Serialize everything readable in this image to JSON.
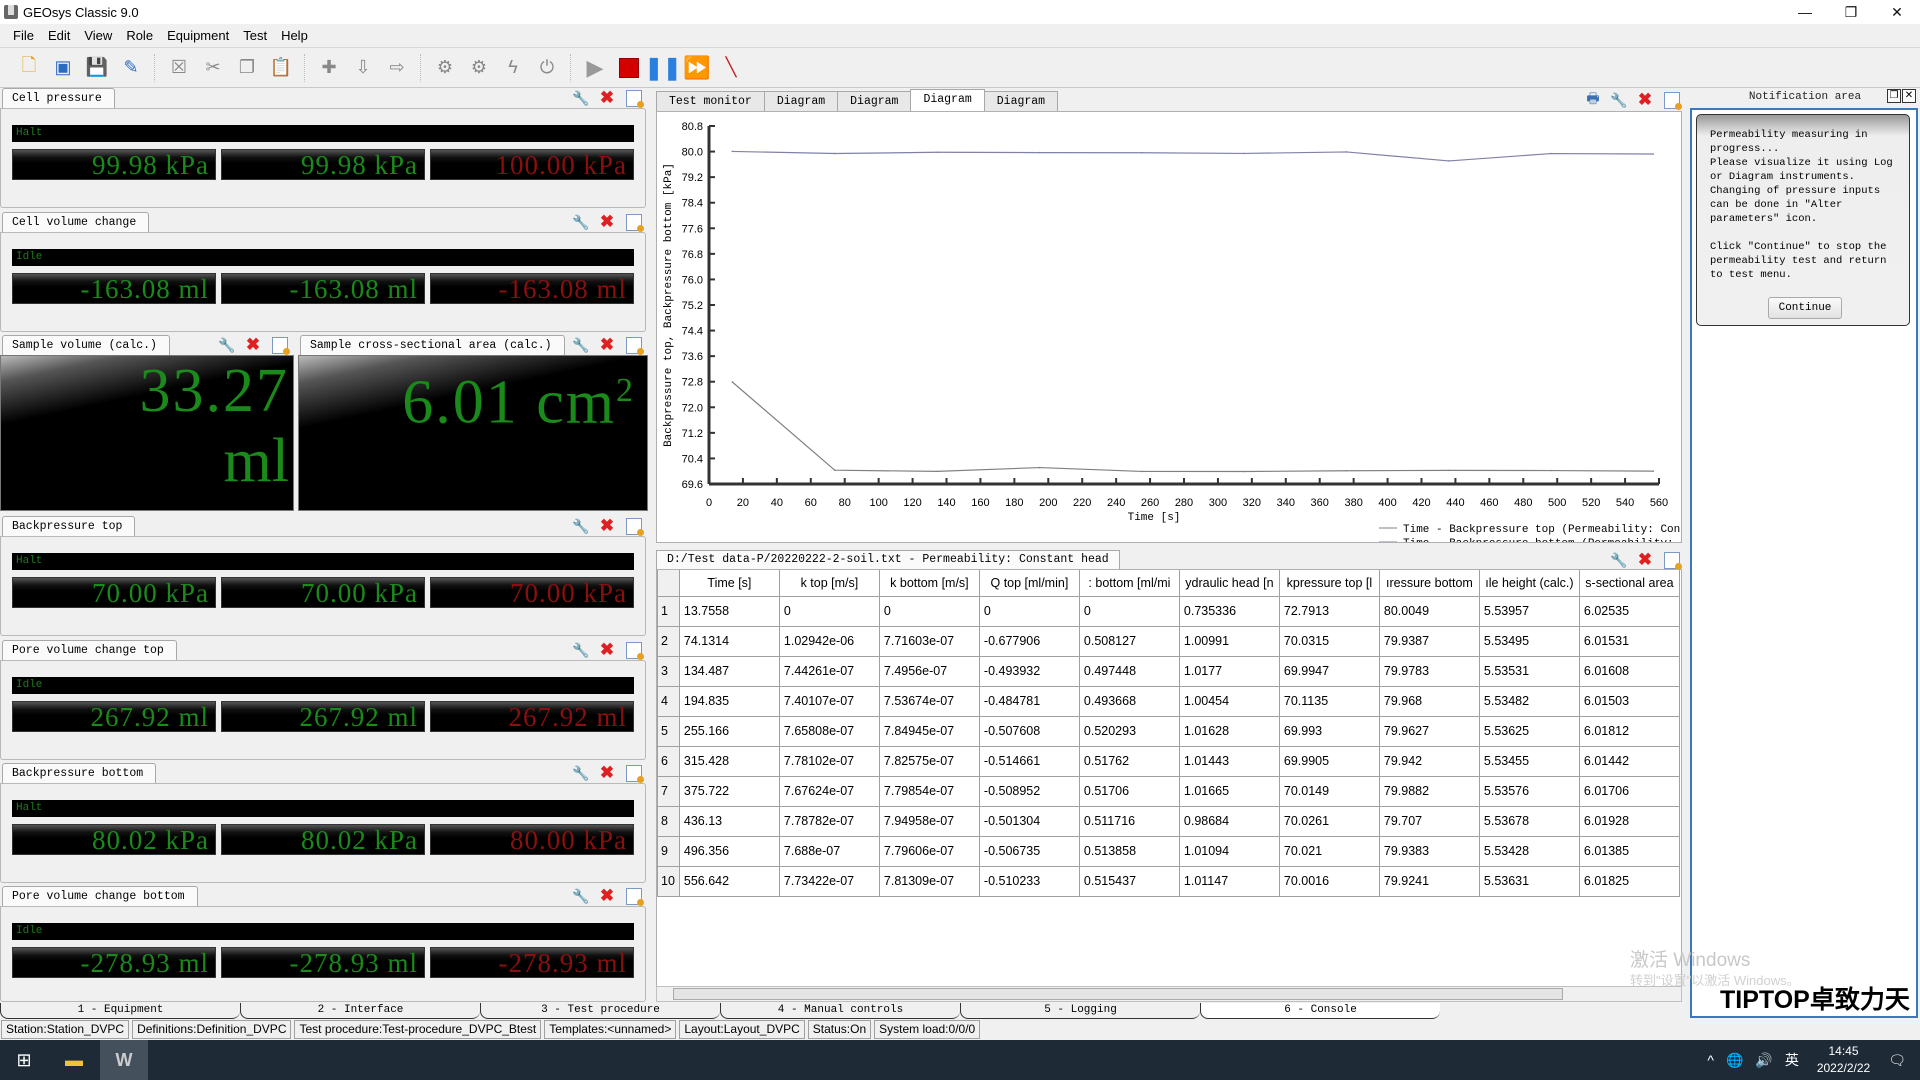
{
  "window": {
    "title": "GEOsys Classic 9.0",
    "controls": [
      "minimize",
      "restore",
      "close"
    ]
  },
  "menu": [
    "File",
    "Edit",
    "View",
    "Role",
    "Equipment",
    "Test",
    "Help"
  ],
  "toolbar": {
    "icons": [
      "new-file-icon",
      "open-icon",
      "save-icon",
      "edit-icon",
      "delete-icon",
      "cut-icon",
      "copy-icon",
      "paste-icon",
      "add-icon",
      "move-down-icon",
      "move-right-icon",
      "connect-icon",
      "disconnect-icon",
      "lightning-icon",
      "power-icon",
      "play-icon",
      "stop-icon",
      "pause-icon",
      "fast-forward-icon",
      "tool-icon"
    ]
  },
  "panels": [
    {
      "title": "Cell pressure",
      "status": "Halt",
      "values": [
        "99.98 kPa",
        "99.98 kPa",
        "100.00 kPa"
      ]
    },
    {
      "title": "Cell volume change",
      "status": "Idle",
      "values": [
        "-163.08 ml",
        "-163.08 ml",
        "-163.08 ml"
      ]
    },
    {
      "title": "Backpressure top",
      "status": "Halt",
      "values": [
        "70.00 kPa",
        "70.00 kPa",
        "70.00 kPa"
      ]
    },
    {
      "title": "Pore volume change top",
      "status": "Idle",
      "values": [
        "267.92 ml",
        "267.92 ml",
        "267.92 ml"
      ]
    },
    {
      "title": "Backpressure bottom",
      "status": "Halt",
      "values": [
        "80.02 kPa",
        "80.02 kPa",
        "80.00 kPa"
      ]
    },
    {
      "title": "Pore volume change bottom",
      "status": "Idle",
      "values": [
        "-278.93 ml",
        "-278.93 ml",
        "-278.93 ml"
      ]
    }
  ],
  "calc": {
    "volume": {
      "title": "Sample volume (calc.)",
      "value": "33.27",
      "unit": "ml"
    },
    "area": {
      "title": "Sample cross-sectional area (calc.)",
      "value": "6.01",
      "unit": "cm",
      "sup": "2"
    }
  },
  "chart_tabs": [
    "Test monitor",
    "Diagram",
    "Diagram",
    "Diagram",
    "Diagram"
  ],
  "chart_active_tab": 3,
  "chart_data": {
    "type": "line",
    "title": "",
    "xlabel": "Time [s]",
    "ylabel": "Backpressure top, Backpressure bottom [kPa]",
    "xlim": [
      0,
      560
    ],
    "ylim": [
      69.6,
      80.8
    ],
    "xticks": [
      0,
      20,
      40,
      60,
      80,
      100,
      120,
      140,
      160,
      180,
      200,
      220,
      240,
      260,
      280,
      300,
      320,
      340,
      360,
      380,
      400,
      420,
      440,
      460,
      480,
      500,
      520,
      540,
      560
    ],
    "yticks": [
      "80.8",
      "80.0",
      "79.2",
      "78.4",
      "77.6",
      "76.8",
      "76.0",
      "75.2",
      "74.4",
      "73.6",
      "72.8",
      "72.0",
      "71.2",
      "70.4",
      "69.6"
    ],
    "x": [
      13.7558,
      74.1314,
      134.487,
      194.835,
      255.166,
      315.428,
      375.722,
      436.13,
      496.356,
      556.642
    ],
    "series": [
      {
        "name": "Time - Backpressure top (Permeability: Constant head)",
        "color": "#808080",
        "values": [
          72.7913,
          70.0315,
          69.9947,
          70.1135,
          69.993,
          69.9905,
          70.0149,
          70.0261,
          70.021,
          70.0016
        ]
      },
      {
        "name": "Time - Backpressure bottom (Permeability: Constant head)",
        "color": "#8080a8",
        "values": [
          80.0049,
          79.9387,
          79.9783,
          79.968,
          79.9627,
          79.942,
          79.9882,
          79.707,
          79.9383,
          79.9241
        ]
      }
    ],
    "grid": false,
    "legend": "bottom-right"
  },
  "table": {
    "tab_label": "D:/Test data-P/20220222-2-soil.txt - Permeability: Constant head",
    "columns": [
      "Time [s]",
      "k top [m/s]",
      "k bottom [m/s]",
      "Q top [ml/min]",
      ": bottom [ml/mi",
      "ydraulic head [n",
      "kpressure top [l",
      "ıressure bottom",
      "ıle height (calc.)",
      "s-sectional area"
    ],
    "rows": [
      [
        "1",
        "13.7558",
        "0",
        "0",
        "0",
        "0",
        "0.735336",
        "72.7913",
        "80.0049",
        "5.53957",
        "6.02535"
      ],
      [
        "2",
        "74.1314",
        "1.02942e-06",
        "7.71603e-07",
        "-0.677906",
        "0.508127",
        "1.00991",
        "70.0315",
        "79.9387",
        "5.53495",
        "6.01531"
      ],
      [
        "3",
        "134.487",
        "7.44261e-07",
        "7.4956e-07",
        "-0.493932",
        "0.497448",
        "1.0177",
        "69.9947",
        "79.9783",
        "5.53531",
        "6.01608"
      ],
      [
        "4",
        "194.835",
        "7.40107e-07",
        "7.53674e-07",
        "-0.484781",
        "0.493668",
        "1.00454",
        "70.1135",
        "79.968",
        "5.53482",
        "6.01503"
      ],
      [
        "5",
        "255.166",
        "7.65808e-07",
        "7.84945e-07",
        "-0.507608",
        "0.520293",
        "1.01628",
        "69.993",
        "79.9627",
        "5.53625",
        "6.01812"
      ],
      [
        "6",
        "315.428",
        "7.78102e-07",
        "7.82575e-07",
        "-0.514661",
        "0.51762",
        "1.01443",
        "69.9905",
        "79.942",
        "5.53455",
        "6.01442"
      ],
      [
        "7",
        "375.722",
        "7.67624e-07",
        "7.79854e-07",
        "-0.508952",
        "0.51706",
        "1.01665",
        "70.0149",
        "79.9882",
        "5.53576",
        "6.01706"
      ],
      [
        "8",
        "436.13",
        "7.78782e-07",
        "7.94958e-07",
        "-0.501304",
        "0.511716",
        "0.98684",
        "70.0261",
        "79.707",
        "5.53678",
        "6.01928"
      ],
      [
        "9",
        "496.356",
        "7.688e-07",
        "7.79606e-07",
        "-0.506735",
        "0.513858",
        "1.01094",
        "70.021",
        "79.9383",
        "5.53428",
        "6.01385"
      ],
      [
        "10",
        "556.642",
        "7.73422e-07",
        "7.81309e-07",
        "-0.510233",
        "0.515437",
        "1.01147",
        "70.0016",
        "79.9241",
        "5.53631",
        "6.01825"
      ]
    ]
  },
  "bottom_tabs": [
    "1 - Equipment",
    "2 - Interface",
    "3 - Test procedure",
    "4 - Manual controls",
    "5 - Logging",
    "6 - Console"
  ],
  "bottom_active_tab": 5,
  "status": [
    "Station:Station_DVPC",
    "Definitions:Definition_DVPC",
    "Test procedure:Test-procedure_DVPC_Btest",
    "Templates:<unnamed>",
    "Layout:Layout_DVPC",
    "Status:On",
    "System load:0/0/0"
  ],
  "notification": {
    "title": "Notification area",
    "text": "Permeability measuring in\nprogress...\nPlease visualize it using Log\nor Diagram instruments.\nChanging of pressure inputs\ncan be done in \"Alter\nparameters\" icon.\n\nClick \"Continue\" to stop the\npermeability test and return\nto test menu.",
    "button": "Continue"
  },
  "watermark": {
    "line1": "激活 Windows",
    "line2": "转到\"设置\"以激活 Windows。",
    "brand": "TIPTOP卓致力天"
  },
  "taskbar": {
    "time": "14:45",
    "date": "2022/2/22",
    "ime": "英",
    "notifications": "1"
  }
}
